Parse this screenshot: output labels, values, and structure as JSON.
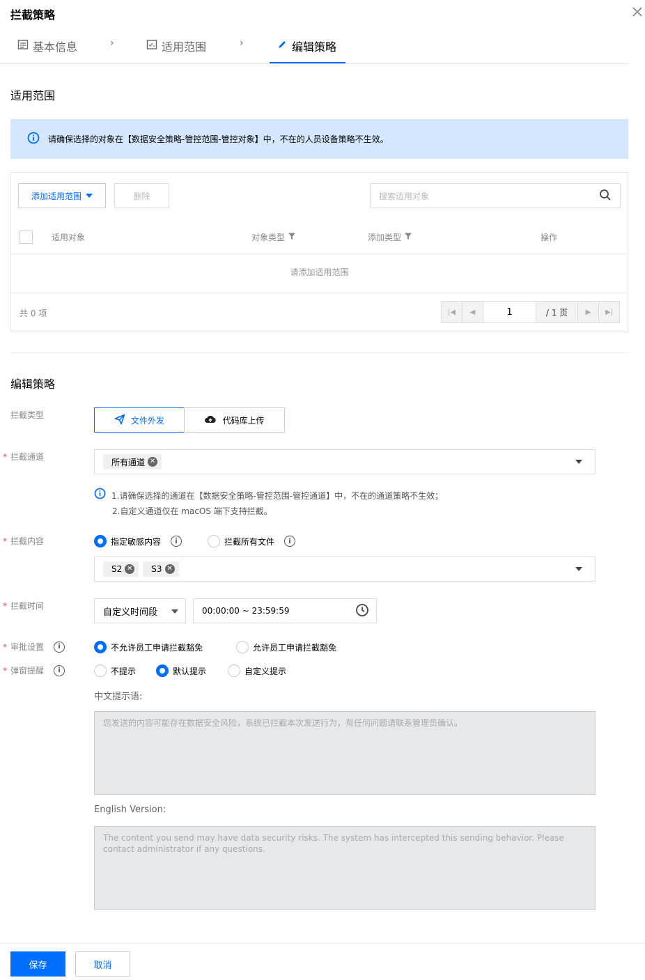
{
  "dialog": {
    "title": "拦截策略"
  },
  "steps": [
    {
      "label": "基本信息"
    },
    {
      "label": "适用范围"
    },
    {
      "label": "编辑策略"
    }
  ],
  "scope": {
    "title": "适用范围",
    "notice": "请确保选择的对象在【数据安全策略-管控范围-管控对象】中，不在的人员设备策略不生效。",
    "add_button": "添加适用范围",
    "delete_button": "删除",
    "search_placeholder": "搜索适用对象",
    "columns": [
      "适用对象",
      "对象类型",
      "添加类型",
      "操作"
    ],
    "empty_text": "请添加适用范围",
    "total": "共 0 项",
    "pager": {
      "page": "1",
      "pages_text": "/ 1 页"
    }
  },
  "policy": {
    "title": "编辑策略",
    "intercept_type": {
      "label": "拦截类型",
      "options": [
        "文件外发",
        "代码库上传"
      ],
      "selected": "文件外发"
    },
    "channel": {
      "label": "拦截通道",
      "tags": [
        "所有通道"
      ],
      "hint_lines": [
        "1.请确保选择的通道在【数据安全策略-管控范围-管控通道】中，不在的通道策略不生效；",
        "2.自定义通道仅在 macOS 端下支持拦截。"
      ]
    },
    "content": {
      "label": "拦截内容",
      "options": [
        "指定敏感内容",
        "拦截所有文件"
      ],
      "selected": "指定敏感内容",
      "tags": [
        "S2",
        "S3"
      ]
    },
    "time": {
      "label": "拦截时间",
      "mode": "自定义时间段",
      "range": "00:00:00 ~ 23:59:59"
    },
    "approval": {
      "label": "审批设置",
      "options": [
        "不允许员工申请拦截豁免",
        "允许员工申请拦截豁免"
      ],
      "selected": "不允许员工申请拦截豁免"
    },
    "popup": {
      "label": "弹窗提醒",
      "options": [
        "不提示",
        "默认提示",
        "自定义提示"
      ],
      "selected": "默认提示",
      "cn_label": "中文提示语:",
      "cn_text": "您发送的内容可能存在数据安全风险，系统已拦截本次发送行为，有任何问题请联系管理员确认。",
      "en_label": "English Version:",
      "en_text": "The content you send may have data security risks. The system has intercepted this sending behavior. Please contact administrator if any questions."
    }
  },
  "footer": {
    "save": "保存",
    "cancel": "取消"
  },
  "colors": {
    "accent": "#006eff",
    "notice_bg": "#d5e7ff",
    "required": "#e54545"
  }
}
